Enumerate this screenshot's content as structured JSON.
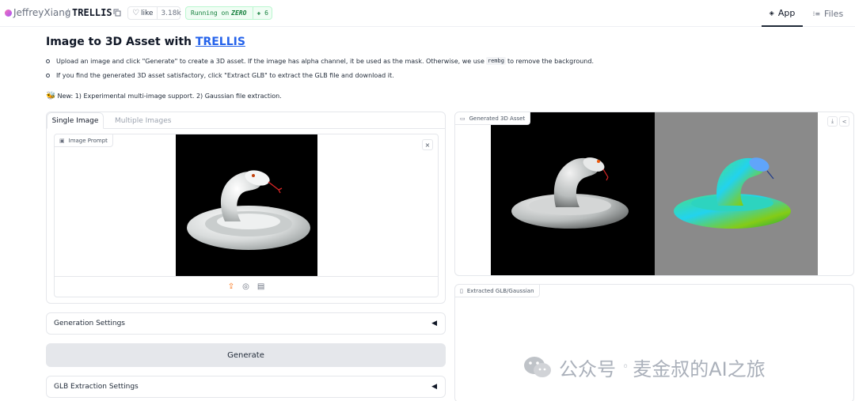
{
  "header": {
    "owner": "JeffreyXiang",
    "separator": "/",
    "repo": "TRELLIS",
    "like_label": "like",
    "like_count": "3.18k",
    "status_text": "Running on",
    "status_hardware": "ZERO",
    "status_extra": "6",
    "tabs": [
      {
        "label": "App",
        "icon": "cube-icon"
      },
      {
        "label": "Files",
        "icon": "files-icon"
      }
    ]
  },
  "intro": {
    "title_prefix": "Image to 3D Asset with ",
    "title_link": "TRELLIS",
    "bullet1_a": "Upload an image and click \"Generate\" to create a 3D asset. If the image has alpha channel, it be used as the mask. Otherwise, we use",
    "bullet1_code": "rembg",
    "bullet1_b": "to remove the background.",
    "bullet2": "If you find the generated 3D asset satisfactory, click \"Extract GLB\" to extract the GLB file and download it.",
    "news": "New: 1) Experimental multi-image support. 2) Gaussian file extraction."
  },
  "left": {
    "tabs": [
      "Single Image",
      "Multiple Images"
    ],
    "image_prompt_label": "Image Prompt",
    "close_symbol": "×",
    "generation_settings": "Generation Settings",
    "generate_button": "Generate",
    "glb_settings": "GLB Extraction Settings",
    "caret": "◀"
  },
  "right": {
    "generated_label": "Generated 3D Asset",
    "extracted_label": "Extracted GLB/Gaussian"
  },
  "watermark": {
    "text": "公众号",
    "author": "麦金叔的AI之旅",
    "sep": "◦"
  },
  "colors": {
    "link": "#2563eb",
    "status_green": "#15803d",
    "upload_orange": "#f97316"
  }
}
